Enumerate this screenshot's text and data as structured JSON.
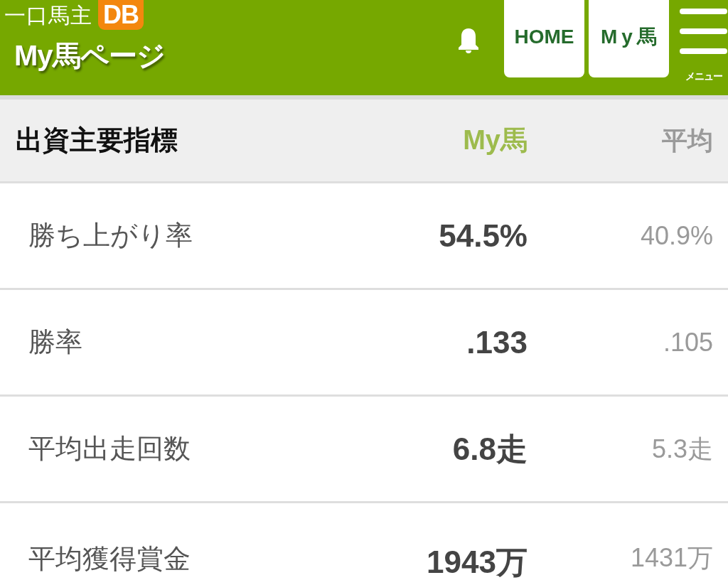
{
  "header": {
    "logo_text": "一口馬主",
    "logo_badge": "DB",
    "page_title": "My馬ページ",
    "nav_buttons": [
      "HOME",
      "My馬"
    ],
    "menu_label": "メニュー"
  },
  "table": {
    "columns": [
      "出資主要指標",
      "My馬",
      "平均"
    ],
    "rows": [
      {
        "label": "勝ち上がり率",
        "mine": "54.5%",
        "average": "40.9%"
      },
      {
        "label": "勝率",
        "mine": ".133",
        "average": ".105"
      },
      {
        "label": "平均出走回数",
        "mine": "6.8走",
        "average": "5.3走"
      },
      {
        "label": "平均獲得賞金",
        "mine": "1943万",
        "average": "1431万"
      }
    ]
  }
}
